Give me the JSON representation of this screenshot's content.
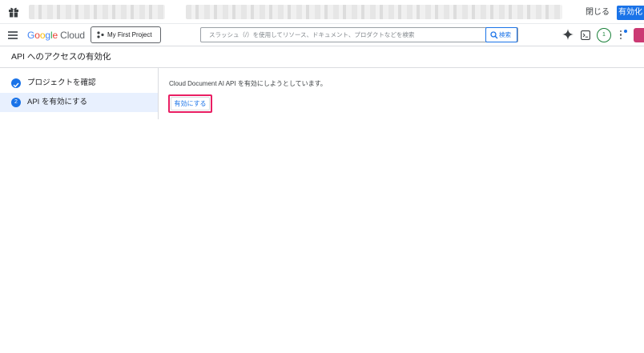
{
  "topbar": {
    "close_label": "閉じる",
    "enable_label": "有効化"
  },
  "header": {
    "logo_letters": [
      "G",
      "o",
      "o",
      "g",
      "l",
      "e"
    ],
    "logo_product": "Cloud",
    "project_label": "My First Project",
    "search_placeholder": "スラッシュ（/）を使用してリソース、ドキュメント、プロダクトなどを検索",
    "search_button": "検索",
    "notification_count": "1"
  },
  "page": {
    "title": "API へのアクセスの有効化"
  },
  "steps": [
    {
      "label": "プロジェクトを確認",
      "state": "done"
    },
    {
      "label": "API を有効にする",
      "number": "2",
      "state": "active"
    }
  ],
  "main": {
    "description": "Cloud Document AI API を有効にしようとしています。",
    "enable_button": "有効にする"
  },
  "colors": {
    "accent": "#1a73e8",
    "highlight": "#e91e63",
    "active_step_bg": "#e8f0fe"
  },
  "icons": [
    "gift-icon",
    "menu-icon",
    "project-icon",
    "search-icon",
    "gemini-icon",
    "terminal-icon",
    "more-vert-icon",
    "check-icon"
  ]
}
